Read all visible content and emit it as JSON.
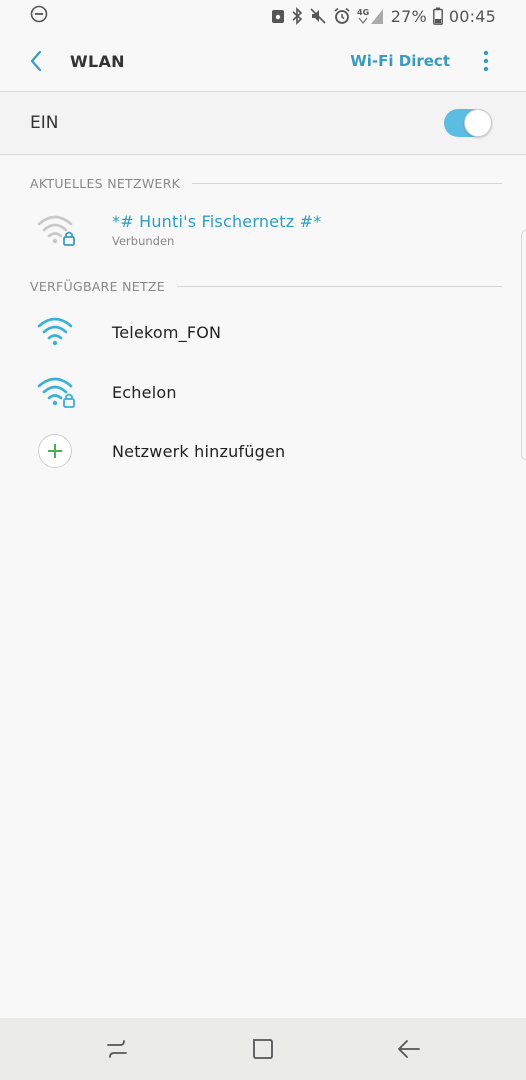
{
  "status_bar": {
    "battery_percent": "27%",
    "time": "00:45",
    "network_type": "4G",
    "icons": [
      "dnd-icon",
      "lock-app-icon",
      "bluetooth-icon",
      "mute-icon",
      "alarm-icon",
      "signal-icon",
      "battery-icon"
    ]
  },
  "app_bar": {
    "title": "WLAN",
    "wifi_direct_label": "Wi-Fi Direct",
    "back_icon": "chevron-left-icon",
    "more_icon": "more-vert-icon"
  },
  "master_switch": {
    "label": "EIN",
    "state": "on"
  },
  "current_network": {
    "section_title": "AKTUELLES NETZWERK",
    "name": "*# Hunti's Fischernetz #*",
    "status": "Verbunden",
    "secured": true,
    "icon": "wifi-lock-icon"
  },
  "available_networks": {
    "section_title": "VERFÜGBARE NETZE",
    "items": [
      {
        "name": "Telekom_FON",
        "secured": false,
        "icon": "wifi-icon"
      },
      {
        "name": "Echelon",
        "secured": true,
        "icon": "wifi-lock-icon"
      }
    ],
    "add_label": "Netzwerk hinzufügen",
    "add_icon": "plus-icon"
  },
  "nav_bar": {
    "icons": [
      "recents-icon",
      "home-icon",
      "back-icon"
    ]
  },
  "colors": {
    "accent": "#2d9fc0",
    "toggle_on": "#5cbde3",
    "add_plus": "#4caf50"
  }
}
